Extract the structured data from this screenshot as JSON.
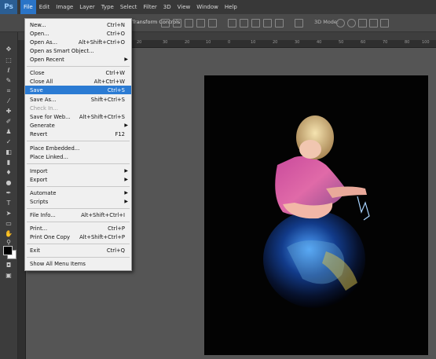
{
  "app": {
    "logo": "Ps"
  },
  "menubar": [
    "File",
    "Edit",
    "Image",
    "Layer",
    "Type",
    "Select",
    "Filter",
    "3D",
    "View",
    "Window",
    "Help"
  ],
  "options": {
    "transform_label": "Transform Controls",
    "mode_label": "3D Mode:"
  },
  "ruler_top": [
    "20",
    "30",
    "20",
    "10",
    "0",
    "10",
    "20",
    "30",
    "40",
    "50",
    "60",
    "70",
    "80",
    "90",
    "100"
  ],
  "file_menu": [
    {
      "label": "New...",
      "shortcut": "Ctrl+N"
    },
    {
      "label": "Open...",
      "shortcut": "Ctrl+O"
    },
    {
      "label": "Browse in Bridge...",
      "shortcut": "Alt+Ctrl+O"
    },
    {
      "label": "Open As...",
      "shortcut": "Alt+Shift+Ctrl+O"
    },
    {
      "label": "Open as Smart Object...",
      "shortcut": ""
    },
    {
      "label": "Open Recent",
      "shortcut": "",
      "submenu": true
    },
    {
      "label": "Close",
      "shortcut": "Ctrl+W"
    },
    {
      "label": "Close All",
      "shortcut": "Alt+Ctrl+W"
    },
    {
      "label": "Save",
      "shortcut": "Ctrl+S"
    },
    {
      "label": "Save As...",
      "shortcut": "Shift+Ctrl+S"
    },
    {
      "label": "Check In...",
      "shortcut": ""
    },
    {
      "label": "Save for Web...",
      "shortcut": "Alt+Shift+Ctrl+S"
    },
    {
      "label": "Generate",
      "shortcut": "",
      "submenu": true
    },
    {
      "label": "Revert",
      "shortcut": "F12"
    },
    {
      "label": "Place Embedded...",
      "shortcut": ""
    },
    {
      "label": "Place Linked...",
      "shortcut": ""
    },
    {
      "label": "Import",
      "shortcut": "",
      "submenu": true
    },
    {
      "label": "Export",
      "shortcut": "",
      "submenu": true
    },
    {
      "label": "Automate",
      "shortcut": "",
      "submenu": true
    },
    {
      "label": "Scripts",
      "shortcut": "",
      "submenu": true
    },
    {
      "label": "File Info...",
      "shortcut": "Alt+Shift+Ctrl+I"
    },
    {
      "label": "Print...",
      "shortcut": "Ctrl+P"
    },
    {
      "label": "Print One Copy",
      "shortcut": "Alt+Shift+Ctrl+P"
    },
    {
      "label": "Exit",
      "shortcut": "Ctrl+Q"
    },
    {
      "label": "Show All Menu Items",
      "shortcut": ""
    }
  ],
  "colors": {
    "accent": "#2b7bd3",
    "menubar": "#383838",
    "workspace": "#535353"
  }
}
